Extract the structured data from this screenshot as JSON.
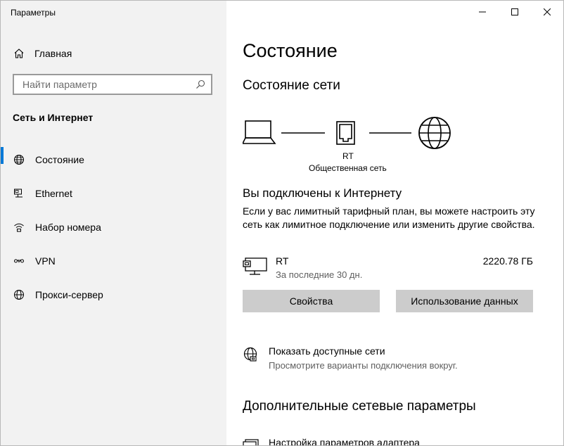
{
  "window": {
    "title": "Параметры"
  },
  "sidebar": {
    "home_label": "Главная",
    "search_placeholder": "Найти параметр",
    "section_title": "Сеть и Интернет",
    "items": [
      {
        "label": "Состояние",
        "icon": "globe-icon",
        "active": true
      },
      {
        "label": "Ethernet",
        "icon": "ethernet-icon",
        "active": false
      },
      {
        "label": "Набор номера",
        "icon": "dialup-icon",
        "active": false
      },
      {
        "label": "VPN",
        "icon": "vpn-icon",
        "active": false
      },
      {
        "label": "Прокси-сервер",
        "icon": "globe-icon",
        "active": false
      }
    ]
  },
  "main": {
    "title": "Состояние",
    "network_status_title": "Состояние сети",
    "diagram": {
      "network_name": "RT",
      "network_type": "Общественная сеть"
    },
    "connected_title": "Вы подключены к Интернету",
    "connected_desc": "Если у вас лимитный тарифный план, вы можете настроить эту сеть как лимитное подключение или изменить другие свойства.",
    "usage": {
      "name": "RT",
      "period": "За последние 30 дн.",
      "value": "2220.78 ГБ"
    },
    "buttons": {
      "properties": "Свойства",
      "data_usage": "Использование данных"
    },
    "available": {
      "title": "Показать доступные сети",
      "subtitle": "Просмотрите варианты подключения вокруг."
    },
    "advanced_title": "Дополнительные сетевые параметры",
    "adapter_title": "Настройка параметров адаптера"
  },
  "colors": {
    "accent": "#0078d7",
    "sidebar_bg": "#f2f2f2",
    "button_bg": "#cccccc"
  }
}
